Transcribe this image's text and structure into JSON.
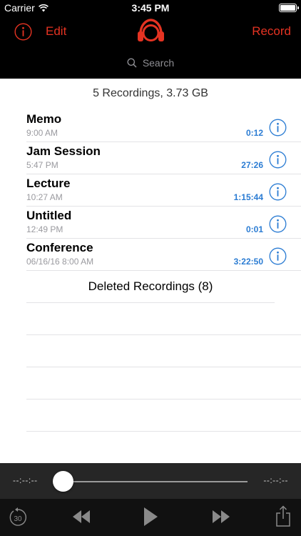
{
  "status_bar": {
    "carrier": "Carrier",
    "time": "3:45 PM"
  },
  "nav": {
    "edit_label": "Edit",
    "record_label": "Record",
    "accent_color": "#e53322"
  },
  "search": {
    "placeholder": "Search"
  },
  "summary": "5 Recordings, 3.73 GB",
  "recordings": [
    {
      "name": "Memo",
      "date": "9:00 AM",
      "duration": "0:12"
    },
    {
      "name": "Jam Session",
      "date": "5:47 PM",
      "duration": "27:26"
    },
    {
      "name": "Lecture",
      "date": "10:27 AM",
      "duration": "1:15:44"
    },
    {
      "name": "Untitled",
      "date": "12:49 PM",
      "duration": "0:01"
    },
    {
      "name": "Conference",
      "date": "06/16/16 8:00 AM",
      "duration": "3:22:50"
    }
  ],
  "deleted_label": "Deleted Recordings (8)",
  "player": {
    "elapsed": "--:--:--",
    "remaining": "--:--:--",
    "progress": 0,
    "skip_back_label": "30"
  },
  "icons": {
    "info": "info-circle-icon",
    "logo": "headphones-logo-icon",
    "search": "search-icon",
    "rewind": "rewind-icon",
    "play": "play-icon",
    "fast_forward": "fast-forward-icon",
    "skip_back": "skip-back-30-icon",
    "share": "share-icon"
  }
}
